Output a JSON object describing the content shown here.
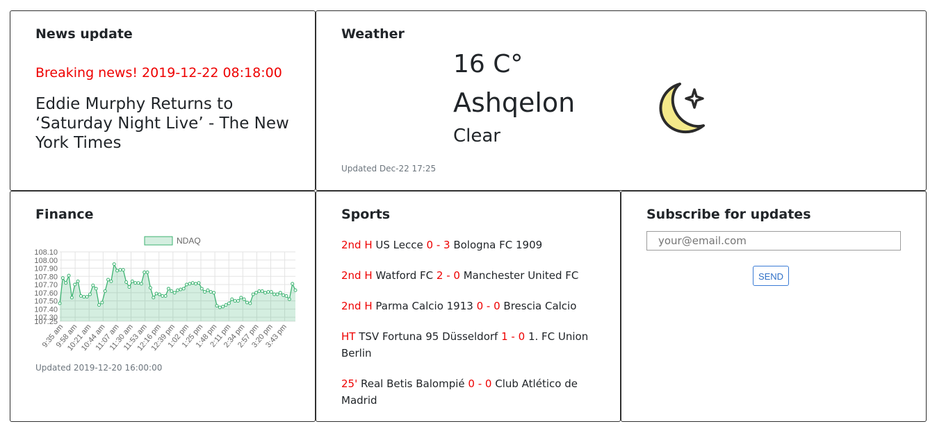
{
  "news": {
    "title": "News update",
    "breaking": "Breaking news! 2019-12-22 08:18:00",
    "headline": "Eddie Murphy Returns to ‘Saturday Night Live’ - The New York Times"
  },
  "weather": {
    "title": "Weather",
    "temp": "16 C°",
    "city": "Ashqelon",
    "description": "Clear",
    "updated": "Updated Dec-22 17:25",
    "icon": "moon-stars-icon"
  },
  "finance": {
    "title": "Finance",
    "updated": "Updated 2019-12-20 16:00:00"
  },
  "chart_data": {
    "type": "area",
    "title": "",
    "xlabel": "",
    "ylabel": "",
    "legend": "top",
    "grid": true,
    "ylim": [
      107.25,
      108.1
    ],
    "yticks": [
      "108.10",
      "108.00",
      "107.90",
      "107.80",
      "107.70",
      "107.60",
      "107.50",
      "107.40",
      "107.30",
      "107.25"
    ],
    "xticks": [
      "9:35 am",
      "9:58 am",
      "10:21 am",
      "10:44 am",
      "11:07 am",
      "11:30 am",
      "11:53 am",
      "12:16 pm",
      "12:39 pm",
      "1:02 pm",
      "1:25 pm",
      "1:48 pm",
      "2:11 pm",
      "2:34 pm",
      "2:57 pm",
      "3:20 pm",
      "3:43 pm"
    ],
    "series": [
      {
        "name": "NDAQ",
        "color": "#3cb371",
        "values": [
          107.47,
          107.78,
          107.72,
          107.81,
          107.54,
          107.7,
          107.74,
          107.56,
          107.55,
          107.55,
          107.58,
          107.69,
          107.65,
          107.45,
          107.48,
          107.62,
          107.76,
          107.74,
          107.95,
          107.87,
          107.88,
          107.88,
          107.73,
          107.67,
          107.74,
          107.72,
          107.72,
          107.71,
          107.85,
          107.85,
          107.66,
          107.54,
          107.59,
          107.58,
          107.56,
          107.56,
          107.65,
          107.62,
          107.6,
          107.63,
          107.64,
          107.65,
          107.7,
          107.71,
          107.72,
          107.71,
          107.72,
          107.65,
          107.61,
          107.63,
          107.61,
          107.6,
          107.44,
          107.42,
          107.43,
          107.45,
          107.47,
          107.52,
          107.5,
          107.5,
          107.54,
          107.52,
          107.48,
          107.47,
          107.58,
          107.6,
          107.62,
          107.62,
          107.6,
          107.61,
          107.61,
          107.58,
          107.58,
          107.6,
          107.57,
          107.56,
          107.52,
          107.71,
          107.63
        ]
      }
    ]
  },
  "sports": {
    "title": "Sports",
    "matches": [
      {
        "status": "2nd H",
        "home": "US Lecce",
        "score": "0 - 3",
        "away": "Bologna FC 1909"
      },
      {
        "status": "2nd H",
        "home": "Watford FC",
        "score": "2 - 0",
        "away": "Manchester United FC"
      },
      {
        "status": "2nd H",
        "home": "Parma Calcio 1913",
        "score": "0 - 0",
        "away": "Brescia Calcio"
      },
      {
        "status": "HT",
        "home": "TSV Fortuna 95 Düsseldorf",
        "score": "1 - 0",
        "away": "1. FC Union Berlin"
      },
      {
        "status": "25'",
        "home": "Real Betis Balompié",
        "score": "0 - 0",
        "away": "Club Atlético de Madrid"
      }
    ]
  },
  "subscribe": {
    "title": "Subscribe for updates",
    "placeholder": "your@email.com",
    "button": "SEND"
  }
}
